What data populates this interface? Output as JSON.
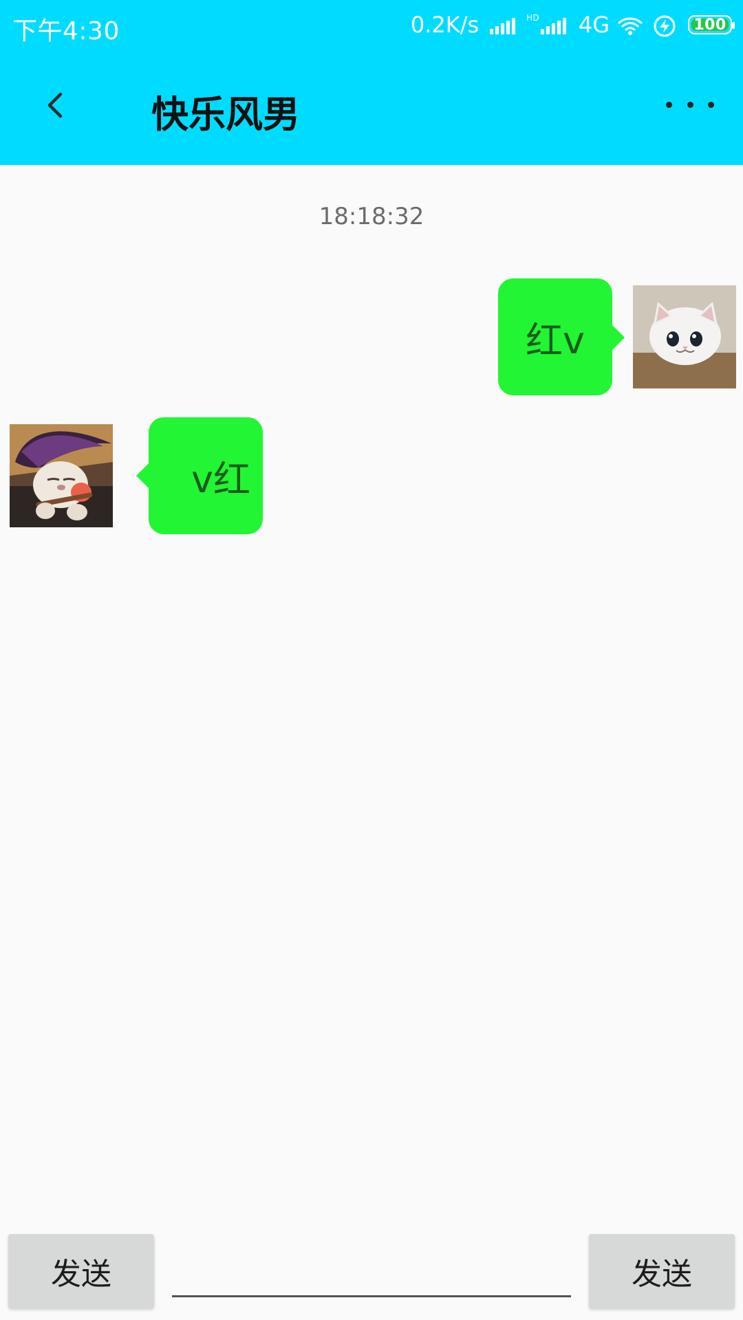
{
  "status_bar": {
    "time": "下午4:30",
    "net_speed": "0.2K/s",
    "hd_label": "HD",
    "network": "4G",
    "battery": "100"
  },
  "app_bar": {
    "title": "快乐风男",
    "back_icon": "back-arrow-icon",
    "more_icon": "more-options-icon"
  },
  "chat": {
    "timestamp": "18:18:32",
    "messages": [
      {
        "side": "right",
        "text": "红v",
        "avatar": "cat-avatar"
      },
      {
        "side": "left",
        "text": "v红",
        "avatar": "yasuo-poro-avatar"
      }
    ]
  },
  "input_bar": {
    "left_button": "发送",
    "right_button": "发送",
    "input_value": "",
    "input_placeholder": ""
  },
  "colors": {
    "app_bar": "#00DCFF",
    "bubble": "#22F533",
    "bubble_text": "#1B5C1D",
    "background": "#FAFAFA",
    "button": "#D7D8D8"
  }
}
